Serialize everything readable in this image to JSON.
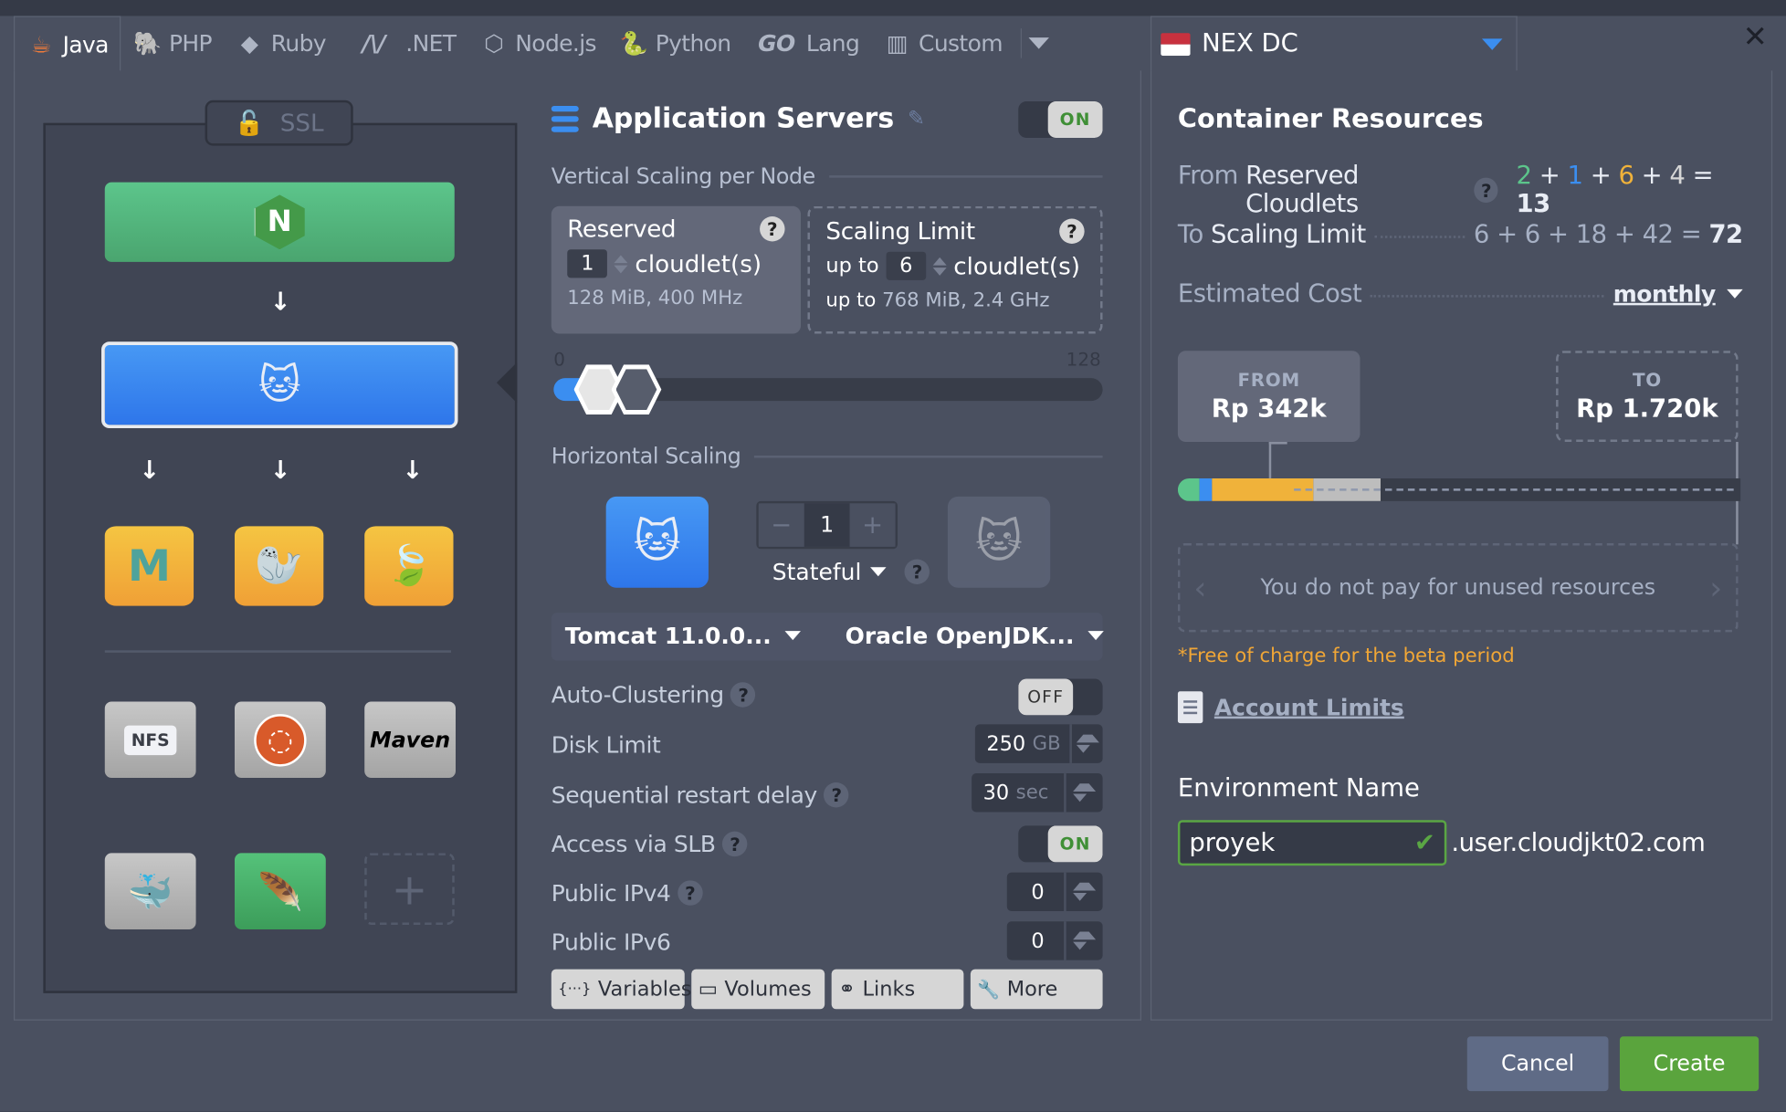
{
  "tabs": [
    {
      "label": "Java",
      "icon": "java-icon",
      "active": true
    },
    {
      "label": "PHP",
      "icon": "php-elephant-icon",
      "active": false
    },
    {
      "label": "Ruby",
      "icon": "ruby-icon",
      "active": false
    },
    {
      "label": ".NET",
      "icon": "dotnet-icon",
      "active": false
    },
    {
      "label": "Node.js",
      "icon": "nodejs-icon",
      "active": false
    },
    {
      "label": "Python",
      "icon": "python-icon",
      "active": false
    },
    {
      "label": "Lang",
      "icon": "go-icon",
      "active": false
    },
    {
      "label": "Custom",
      "icon": "custom-icon",
      "active": false
    }
  ],
  "go_logo": "GO",
  "region": {
    "label": "NEX DC",
    "flag_colors": [
      "#c8313e",
      "#ffffff"
    ]
  },
  "close_glyph": "✕",
  "topology": {
    "ssl_label": "SSL",
    "balancer_letter": "N",
    "nosql_nodes": [
      "memcached",
      "mariadb",
      "mongodb"
    ],
    "tools": [
      "NFS",
      "ubuntu",
      "Maven",
      "docker",
      "feather"
    ],
    "nfs_label": "NFS",
    "maven_label": "Maven",
    "add_glyph": "+",
    "arrow_glyph": "↓"
  },
  "layer": {
    "title": "Application Servers",
    "enabled_label": "ON"
  },
  "vertical": {
    "section_label": "Vertical Scaling per Node",
    "reserved": {
      "title": "Reserved",
      "value": "1",
      "unit": "cloudlet(s)",
      "spec": "128 MiB, 400 MHz"
    },
    "limit": {
      "title": "Scaling Limit",
      "prefix": "up to",
      "value": "6",
      "unit": "cloudlet(s)",
      "spec_prefix": "up to",
      "spec": "768 MiB, 2.4 GHz"
    },
    "slider_min": "0",
    "slider_max": "128",
    "reserved_fraction": 0.0078,
    "limit_fraction": 0.047
  },
  "horizontal": {
    "section_label": "Horizontal Scaling",
    "node_count": "1",
    "minus": "−",
    "plus": "+",
    "mode_label": "Stateful"
  },
  "stack": {
    "server_label": "Tomcat 11.0.0...",
    "jdk_label": "Oracle OpenJDK..."
  },
  "settings": {
    "auto_clustering": {
      "label": "Auto-Clustering",
      "state": "OFF"
    },
    "disk_limit": {
      "label": "Disk Limit",
      "value": "250",
      "unit": "GB"
    },
    "restart_delay": {
      "label": "Sequential restart delay",
      "value": "30",
      "unit": "sec"
    },
    "slb": {
      "label": "Access via SLB",
      "state": "ON"
    },
    "ipv4": {
      "label": "Public IPv4",
      "value": "0"
    },
    "ipv6": {
      "label": "Public IPv6",
      "value": "0"
    }
  },
  "footer_buttons": [
    {
      "label": "Variables",
      "icon": "variables-icon",
      "glyph": "{···}"
    },
    {
      "label": "Volumes",
      "icon": "folder-icon",
      "glyph": "▭"
    },
    {
      "label": "Links",
      "icon": "link-icon",
      "glyph": "⚭"
    },
    {
      "label": "More",
      "icon": "wrench-icon",
      "glyph": "🔧"
    }
  ],
  "resources": {
    "title": "Container Resources",
    "from_prefix": "From",
    "from_label": "Reserved Cloudlets",
    "from_terms": [
      {
        "value": "2",
        "color": "#5cc58b"
      },
      {
        "value": "1",
        "color": "#3b8ef0"
      },
      {
        "value": "6",
        "color": "#f0b23a"
      },
      {
        "value": "4",
        "color": "#d6d6d6"
      }
    ],
    "from_total": "13",
    "to_prefix": "To",
    "to_label": "Scaling Limit",
    "to_terms": [
      "6",
      "6",
      "18",
      "42"
    ],
    "to_total": "72",
    "cost_label": "Estimated Cost",
    "period": "monthly",
    "from_cost_label": "FROM",
    "from_cost": "Rp 342k",
    "to_cost_label": "TO",
    "to_cost": "Rp 1.720k",
    "cost_segments": [
      {
        "name": "balancer",
        "color": "#5cc58b",
        "share": 0.019
      },
      {
        "name": "app-servers",
        "color": "#3b8ef0",
        "share": 0.011
      },
      {
        "name": "databases",
        "color": "#f0b23a",
        "share": 0.09
      },
      {
        "name": "storage",
        "color": "#bdbdbd",
        "share": 0.06
      }
    ],
    "info_text": "You do not pay for unused resources",
    "beta_note": "*Free of charge for the beta period",
    "account_limits": "Account Limits"
  },
  "environment": {
    "label": "Environment Name",
    "value": "proyek",
    "domain_suffix": ".user.cloudjkt02.com"
  },
  "actions": {
    "cancel": "Cancel",
    "create": "Create"
  }
}
